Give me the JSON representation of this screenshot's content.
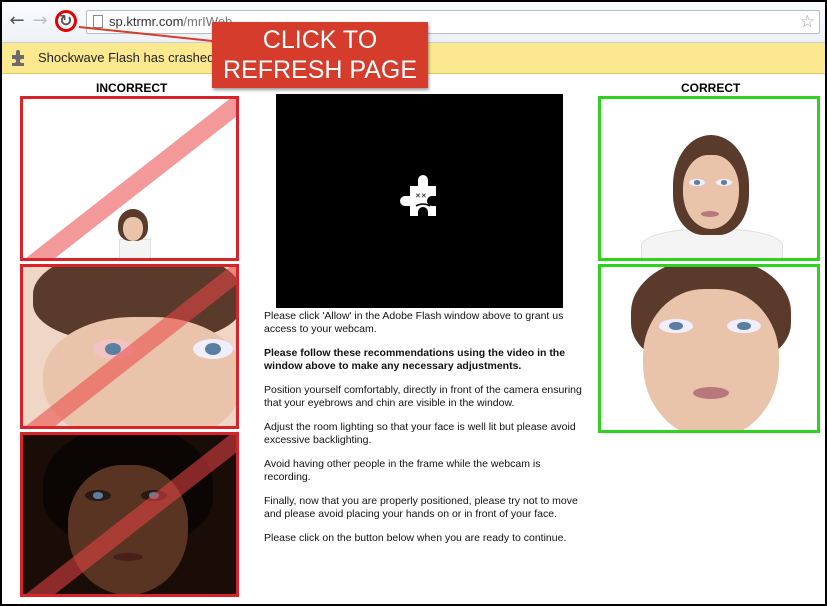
{
  "browser": {
    "url_host": "sp.ktrmr.com",
    "url_path": "/mrIWeb",
    "icons": {
      "back": "back-arrow-icon",
      "forward": "forward-arrow-icon",
      "reload": "reload-icon",
      "bookmark": "star-icon"
    }
  },
  "infobar": {
    "message": "Shockwave Flash has crashed.",
    "icon": "plugin-puzzle-icon"
  },
  "callout": {
    "line1": "CLICK TO",
    "line2": "REFRESH PAGE",
    "color": "#d63c2c"
  },
  "headings": {
    "incorrect": "INCORRECT",
    "correct": "CORRECT"
  },
  "colors": {
    "incorrect_border": "#d9232a",
    "correct_border": "#2fd21e",
    "infobar_bg": "#fce98f"
  },
  "instructions": [
    {
      "text": "Please click 'Allow' in the Adobe Flash window above to grant us access to your webcam.",
      "bold": false
    },
    {
      "text": "Please follow these recommendations using the video in the window above to make any necessary adjustments.",
      "bold": true
    },
    {
      "text": "Position yourself comfortably, directly in front of the camera ensuring that your eyebrows and chin are visible in the window.",
      "bold": false
    },
    {
      "text": "Adjust the room lighting so that your face is well lit but please avoid excessive backlighting.",
      "bold": false
    },
    {
      "text": "Avoid having other people in the frame while the webcam is recording.",
      "bold": false
    },
    {
      "text": "Finally, now that you are properly positioned, please try not to move and please avoid placing your hands on or in front of your face.",
      "bold": false
    },
    {
      "text": "Please click on the button below when you are ready to continue.",
      "bold": false
    }
  ]
}
